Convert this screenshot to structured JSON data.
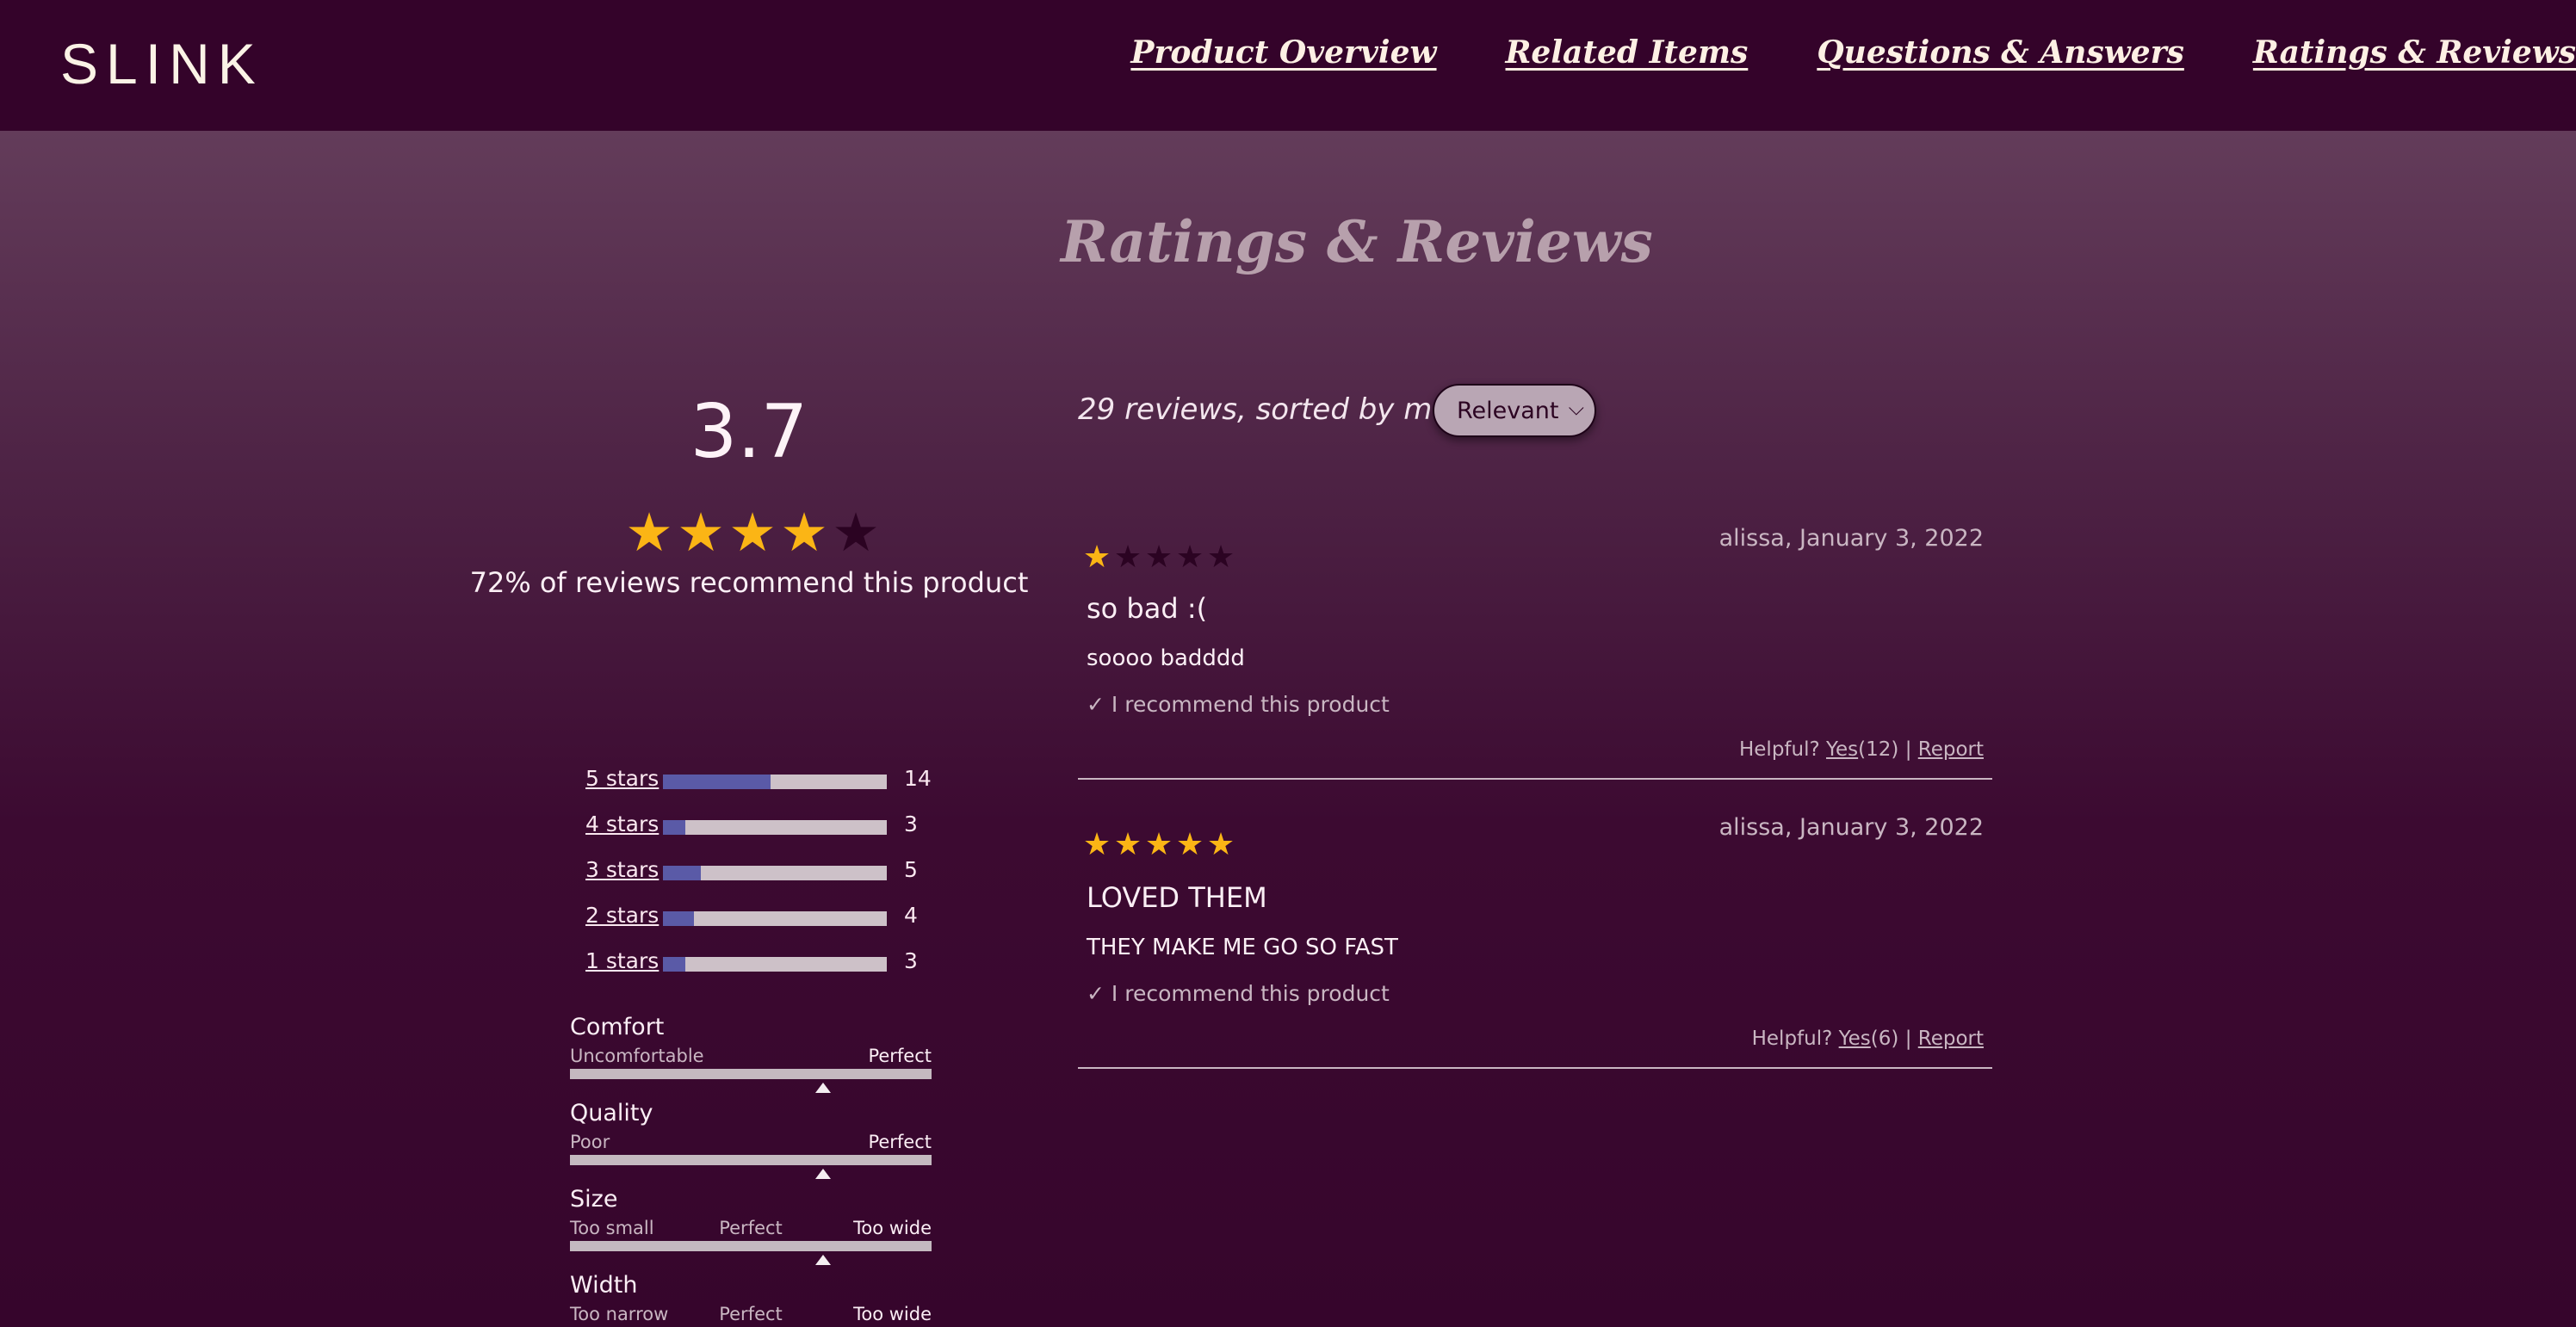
{
  "header": {
    "logo": "SLINK",
    "nav": [
      "Product Overview",
      "Related Items",
      "Questions & Answers",
      "Ratings & Reviews"
    ]
  },
  "section_title": "Ratings & Reviews",
  "summary": {
    "average": "3.7",
    "average_stars": 3.7,
    "recommend_text": "72% of reviews recommend this product",
    "breakdown": [
      {
        "label": "5 stars",
        "count": "14",
        "fraction": 0.48
      },
      {
        "label": "4 stars",
        "count": "3",
        "fraction": 0.1
      },
      {
        "label": "3 stars",
        "count": "5",
        "fraction": 0.17
      },
      {
        "label": "2 stars",
        "count": "4",
        "fraction": 0.14
      },
      {
        "label": "1 stars",
        "count": "3",
        "fraction": 0.1
      }
    ],
    "characteristics": [
      {
        "name": "Comfort",
        "low": "Uncomfortable",
        "mid": "",
        "high": "Perfect",
        "value": 0.7
      },
      {
        "name": "Quality",
        "low": "Poor",
        "mid": "",
        "high": "Perfect",
        "value": 0.7
      },
      {
        "name": "Size",
        "low": "Too small",
        "mid": "Perfect",
        "high": "Too wide",
        "value": 0.7
      },
      {
        "name": "Width",
        "low": "Too narrow",
        "mid": "Perfect",
        "high": "Too wide",
        "value": 0.6
      }
    ]
  },
  "reviews_list": {
    "sort_text": "29 reviews, sorted by most",
    "sort_value": "Relevant",
    "items": [
      {
        "rating": 1,
        "author_date": "alissa,   January 3, 2022",
        "title": "so bad :(",
        "body": "soooo badddd",
        "recommend": "✓ I recommend this product",
        "helpful_label": "Helpful?",
        "yes_label": "Yes",
        "yes_count": "(12)",
        "separator": "|",
        "report_label": "Report"
      },
      {
        "rating": 5,
        "author_date": "alissa,   January 3, 2022",
        "title": "LOVED THEM",
        "body": "THEY MAKE ME GO SO FAST",
        "recommend": "✓ I recommend this product",
        "helpful_label": "Helpful?",
        "yes_label": "Yes",
        "yes_count": "(6)",
        "separator": "|",
        "report_label": "Report"
      }
    ]
  },
  "colors": {
    "star_full": "#fbb515",
    "star_empty": "#2b0322",
    "bar_fill": "#5a5aa7",
    "bar_track": "#cdc1c8"
  }
}
